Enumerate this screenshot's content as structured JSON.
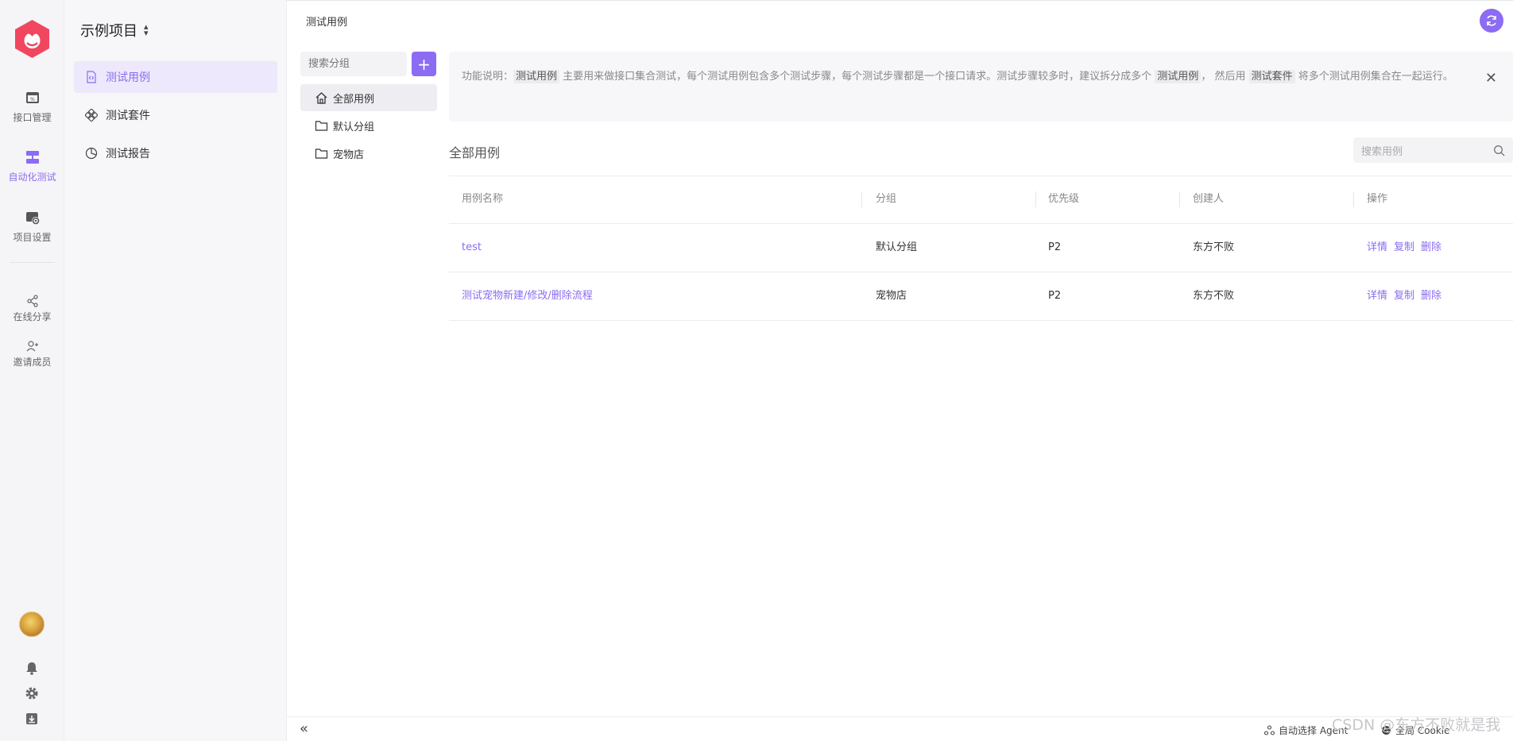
{
  "rail": {
    "items": [
      {
        "label": "接口管理",
        "icon": "api-icon"
      },
      {
        "label": "自动化测试",
        "icon": "automation-icon"
      },
      {
        "label": "项目设置",
        "icon": "settings-gear-icon"
      }
    ],
    "extra": [
      {
        "label": "在线分享",
        "icon": "share-icon"
      },
      {
        "label": "邀请成员",
        "icon": "invite-user-icon"
      }
    ]
  },
  "sidebar": {
    "project_name": "示例项目",
    "items": [
      {
        "label": "测试用例",
        "icon": "file-code-icon"
      },
      {
        "label": "测试套件",
        "icon": "suite-icon"
      },
      {
        "label": "测试报告",
        "icon": "pie-chart-icon"
      }
    ]
  },
  "header": {
    "breadcrumb": "测试用例"
  },
  "groups": {
    "search_placeholder": "搜索分组",
    "add_label": "+",
    "items": [
      {
        "label": "全部用例",
        "icon": "home-icon"
      },
      {
        "label": "默认分组",
        "icon": "folder-icon"
      },
      {
        "label": "宠物店",
        "icon": "folder-icon"
      }
    ]
  },
  "notice": {
    "prefix": "功能说明：",
    "tag1": "测试用例",
    "text1": " 主要用来做接口集合测试，每个测试用例包含多个测试步骤，每个测试步骤都是一个接口请求。测试步骤较多时，建议拆分成多个 ",
    "tag2": "测试用例",
    "text2": "， 然后用 ",
    "tag3": "测试套件",
    "text3": " 将多个测试用例集合在一起运行。",
    "close": "✕"
  },
  "cases": {
    "title": "全部用例",
    "search_placeholder": "搜索用例",
    "columns": [
      "用例名称",
      "分组",
      "优先级",
      "创建人",
      "操作"
    ],
    "rows": [
      {
        "name": "test",
        "group": "默认分组",
        "priority": "P2",
        "creator": "东方不败",
        "actions": [
          "详情",
          "复制",
          "删除"
        ]
      },
      {
        "name": "测试宠物新建/修改/删除流程",
        "group": "宠物店",
        "priority": "P2",
        "creator": "东方不败",
        "actions": [
          "详情",
          "复制",
          "删除"
        ]
      }
    ]
  },
  "bottom": {
    "collapse": "«",
    "agent": "自动选择 Agent",
    "cookie": "全局 Cookie"
  },
  "watermark": "CSDN @东方不败就是我",
  "colors": {
    "accent": "#8b6cf2",
    "logo": "#f0465f"
  }
}
